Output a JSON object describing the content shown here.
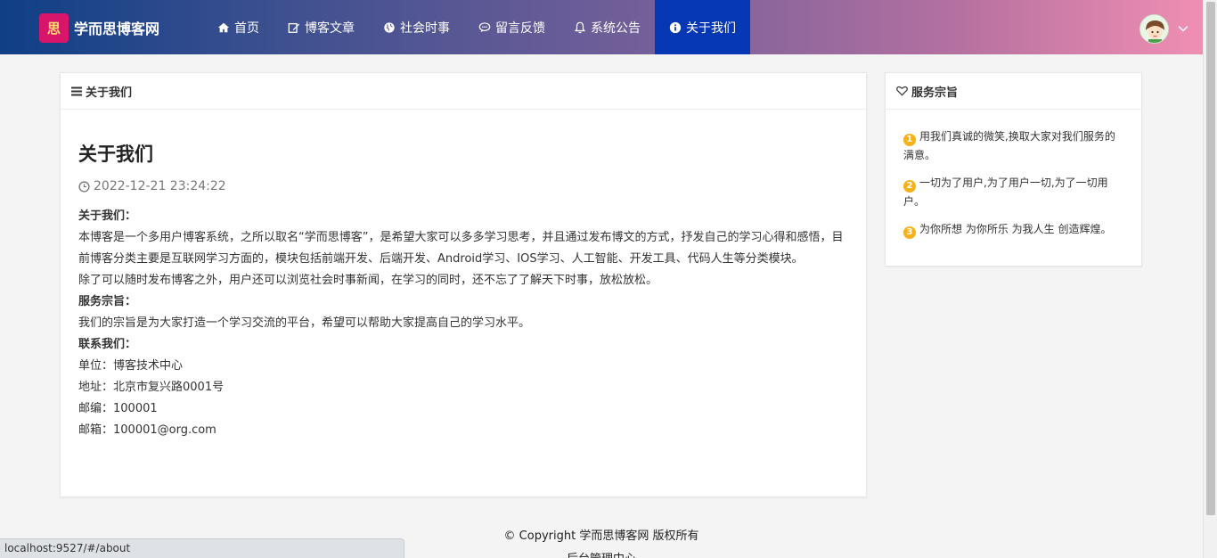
{
  "brand": {
    "logo_text": "思",
    "name": "学而思博客网"
  },
  "nav": [
    {
      "label": "首页",
      "icon": "home-icon"
    },
    {
      "label": "博客文章",
      "icon": "edit-icon"
    },
    {
      "label": "社会时事",
      "icon": "globe-icon"
    },
    {
      "label": "留言反馈",
      "icon": "comment-icon"
    },
    {
      "label": "系统公告",
      "icon": "bell-icon"
    },
    {
      "label": "关于我们",
      "icon": "info-icon",
      "active": true
    }
  ],
  "about_card": {
    "header": "关于我们",
    "title": "关于我们",
    "time": "2022-12-21 23:24:22",
    "paragraphs": [
      {
        "text": "关于我们：",
        "bold": true
      },
      {
        "text": "本博客是一个多用户博客系统，之所以取名“学而思博客”，是希望大家可以多多学习思考，并且通过发布博文的方式，抒发自己的学习心得和感悟，目前博客分类主要是互联网学习方面的，模块包括前端开发、后端开发、Android学习、IOS学习、人工智能、开发工具、代码人生等分类模块。"
      },
      {
        "text": "除了可以随时发布博客之外，用户还可以浏览社会时事新闻，在学习的同时，还不忘了了解天下时事，放松放松。"
      },
      {
        "text": "服务宗旨：",
        "bold": true
      },
      {
        "text": "我们的宗旨是为大家打造一个学习交流的平台，希望可以帮助大家提高自己的学习水平。"
      },
      {
        "text": "联系我们：",
        "bold": true
      },
      {
        "text": "单位：博客技术中心"
      },
      {
        "text": "地址：北京市复兴路0001号"
      },
      {
        "text": "邮编：100001"
      },
      {
        "text": "邮箱：100001@org.com"
      }
    ]
  },
  "service_card": {
    "header": "服务宗旨",
    "items": [
      {
        "num": "1",
        "text": "用我们真诚的微笑,换取大家对我们服务的满意。"
      },
      {
        "num": "2",
        "text": "一切为了用户,为了用户一切,为了一切用户。"
      },
      {
        "num": "3",
        "text": "为你所想 为你所乐 为我人生 创造辉煌。"
      }
    ]
  },
  "footer": {
    "copyright": "© Copyright 学而思博客网 版权所有",
    "admin_link": "后台管理中心"
  },
  "status_bar": {
    "url": "localhost:9527/#/about"
  },
  "colors": {
    "active_nav": "#0638b6",
    "badge": "#f5b21a"
  }
}
